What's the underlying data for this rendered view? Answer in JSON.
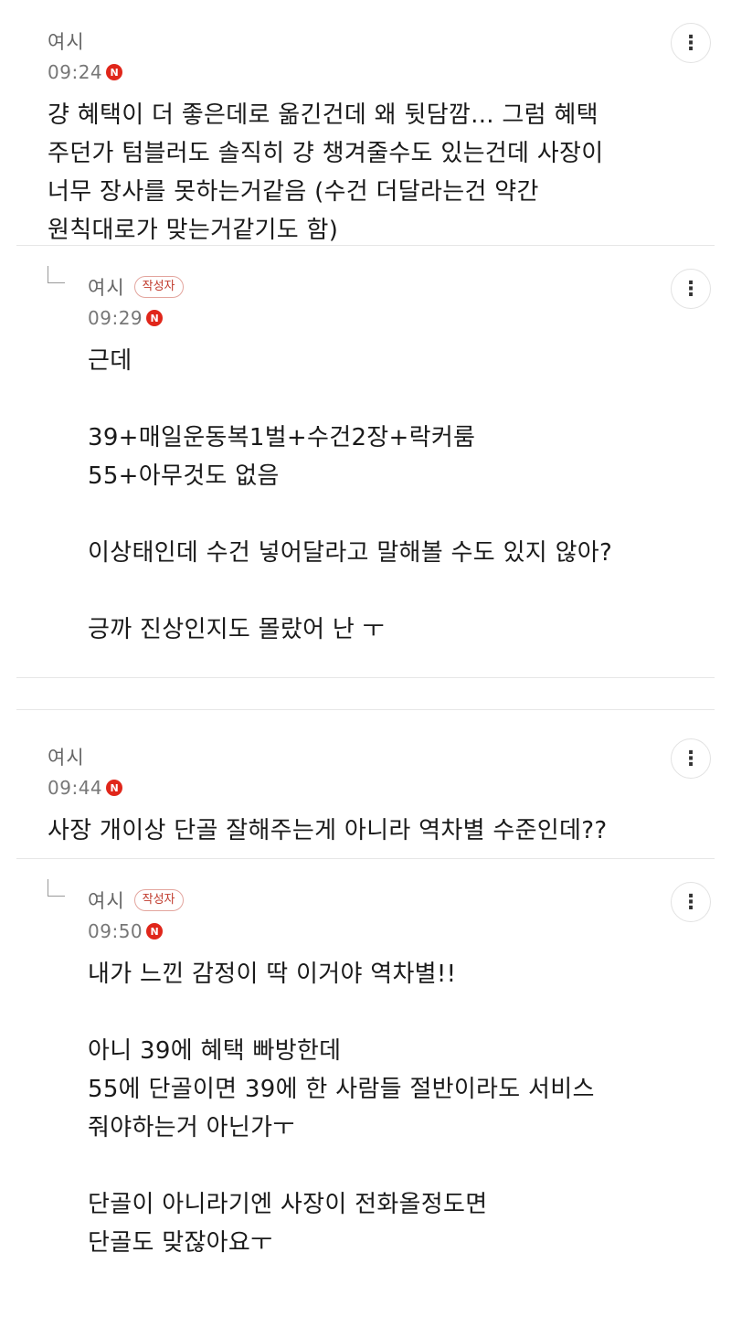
{
  "comments": [
    {
      "author": "여시",
      "time": "09:24",
      "new_badge": "N",
      "is_writer": false,
      "text": "걍 혜택이 더 좋은데로 옮긴건데 왜 뒷담깜... 그럼 혜택\n주던가 텀블러도 솔직히 걍 챙겨줄수도 있는건데 사장이\n너무 장사를 못하는거같음 (수건 더달라는건 약간\n원칙대로가 맞는거같기도 함)"
    },
    {
      "author": "여시",
      "writer_badge": "작성자",
      "time": "09:29",
      "new_badge": "N",
      "is_writer": true,
      "text": "근데\n\n39+매일운동복1벌+수건2장+락커룸\n55+아무것도 없음\n\n이상태인데 수건 넣어달라고 말해볼 수도 있지 않아?\n\n긍까 진상인지도 몰랐어 난 ㅜ"
    },
    {
      "author": "여시",
      "time": "09:44",
      "new_badge": "N",
      "is_writer": false,
      "text": "사장 개이상 단골 잘해주는게 아니라 역차별 수준인데??"
    },
    {
      "author": "여시",
      "writer_badge": "작성자",
      "time": "09:50",
      "new_badge": "N",
      "is_writer": true,
      "text": "내가 느낀 감정이 딱 이거야 역차별!!\n\n아니 39에 혜택 빠방한데\n55에 단골이면 39에 한 사람들 절반이라도 서비스\n줘야하는거 아닌가ㅜ\n\n단골이 아니라기엔 사장이 전화올정도면\n단골도 맞잖아요ㅜ"
    }
  ],
  "icons": {
    "more": "more-vertical-icon",
    "reply": "reply-arrow-icon",
    "new": "new-n-icon"
  },
  "colors": {
    "new_badge": "#e0261a",
    "writer_badge": "#c0392b"
  }
}
